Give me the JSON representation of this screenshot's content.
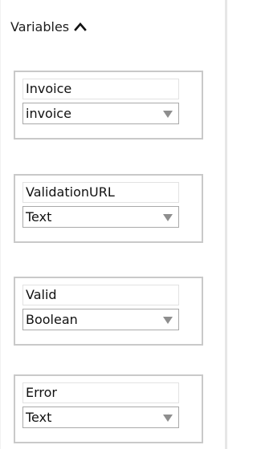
{
  "header": {
    "label": "Variables",
    "caret_icon": "chevron-up-icon"
  },
  "variables": [
    {
      "name": "Invoice",
      "type": "invoice"
    },
    {
      "name": "ValidationURL",
      "type": "Text"
    },
    {
      "name": "Valid",
      "type": "Boolean"
    },
    {
      "name": "Error",
      "type": "Text"
    }
  ],
  "colors": {
    "card_border": "#c9c9c9",
    "select_border": "#a9a9a9",
    "dropdown_arrow": "#8e8e8e"
  }
}
